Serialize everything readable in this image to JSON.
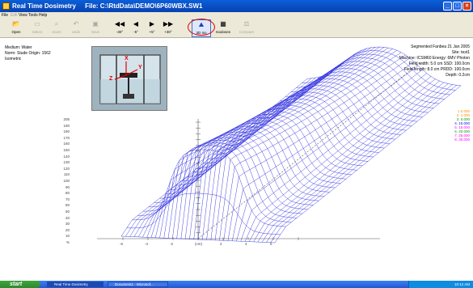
{
  "window": {
    "app_title": "Real Time Dosimetry",
    "file_label": "File: C:\\RtdData\\DEMO\\6P60WBX.SW1"
  },
  "menu": {
    "items": [
      "File",
      "Edit",
      "View",
      "Tools",
      "Help"
    ]
  },
  "toolbar": {
    "buttons": [
      {
        "label": "Open",
        "icon": "open-icon",
        "enabled": true
      },
      {
        "label": "Select",
        "icon": "select-icon",
        "enabled": false
      },
      {
        "label": "Zoom",
        "icon": "zoom-icon",
        "enabled": false
      },
      {
        "label": "Undo",
        "icon": "undo-icon",
        "enabled": false
      },
      {
        "label": "Save",
        "icon": "save-icon",
        "enabled": false
      },
      {
        "label": "-30°",
        "icon": "rotate-left-fast-icon",
        "enabled": true
      },
      {
        "label": "-5°",
        "icon": "rotate-left-icon",
        "enabled": true
      },
      {
        "label": "+5°",
        "icon": "rotate-right-icon",
        "enabled": true
      },
      {
        "label": "+30°",
        "icon": "rotate-right-fast-icon",
        "enabled": true
      },
      {
        "label": "3D Iso",
        "icon": "iso-3d-icon",
        "enabled": true
      },
      {
        "label": "Isodoses",
        "icon": "isodoses-icon",
        "enabled": true
      },
      {
        "label": "Compare",
        "icon": "compare-icon",
        "enabled": false
      }
    ]
  },
  "info_left": {
    "medium": "Medium: Water",
    "origin": "Norm: Stude Origin: 1562",
    "view": "Isometric"
  },
  "info_right": {
    "header": "Segmented Fanbea 21 Jan 2005",
    "site": "Site: test1",
    "machine": "Machine: ICSM60 Energy: 6MV Photon",
    "field_width": "Field width: 5.0 cm SSD: 100.0cm",
    "field_length": "Field length: 8.0 cm PRDD: 100.0cm",
    "depth": "Depth: 0.2cm"
  },
  "legend": {
    "items": [
      {
        "label": "1.0.000",
        "color": "#ff8c00"
      },
      {
        "label": "2. 1.000",
        "color": "#ff8c00"
      },
      {
        "label": "3. 5.000",
        "color": "#00a000"
      },
      {
        "label": "4. 10.000",
        "color": "#0000ff"
      },
      {
        "label": "5. 15.000",
        "color": "#ff00ff"
      },
      {
        "label": "6. 20.000",
        "color": "#00a000"
      },
      {
        "label": "7. 25.000",
        "color": "#ff00ff"
      },
      {
        "label": "8. 30.000",
        "color": "#ff00ff"
      }
    ]
  },
  "yaxis": {
    "ticks": [
      "205",
      "190",
      "180",
      "170",
      "160",
      "150",
      "140",
      "130",
      "120",
      "110",
      "100",
      "90",
      "80",
      "70",
      "60",
      "50",
      "40",
      "30",
      "20",
      "10",
      "%"
    ]
  },
  "xaxis": {
    "ticks": [
      "-6",
      "-4",
      "-2",
      "(cm)",
      "2",
      "4",
      "6"
    ]
  },
  "photo_labels": {
    "x": "X",
    "y": "Y",
    "z": "Z"
  },
  "colors": {
    "mesh": "#3030e0",
    "accent_oval": "#d80000"
  },
  "taskbar": {
    "start": "start",
    "tasks": [
      {
        "label": "Real Time Dosimetry",
        "active": true
      },
      {
        "label": "Document1 - Microsof...",
        "active": false
      }
    ],
    "clock": "10:12 AM"
  }
}
